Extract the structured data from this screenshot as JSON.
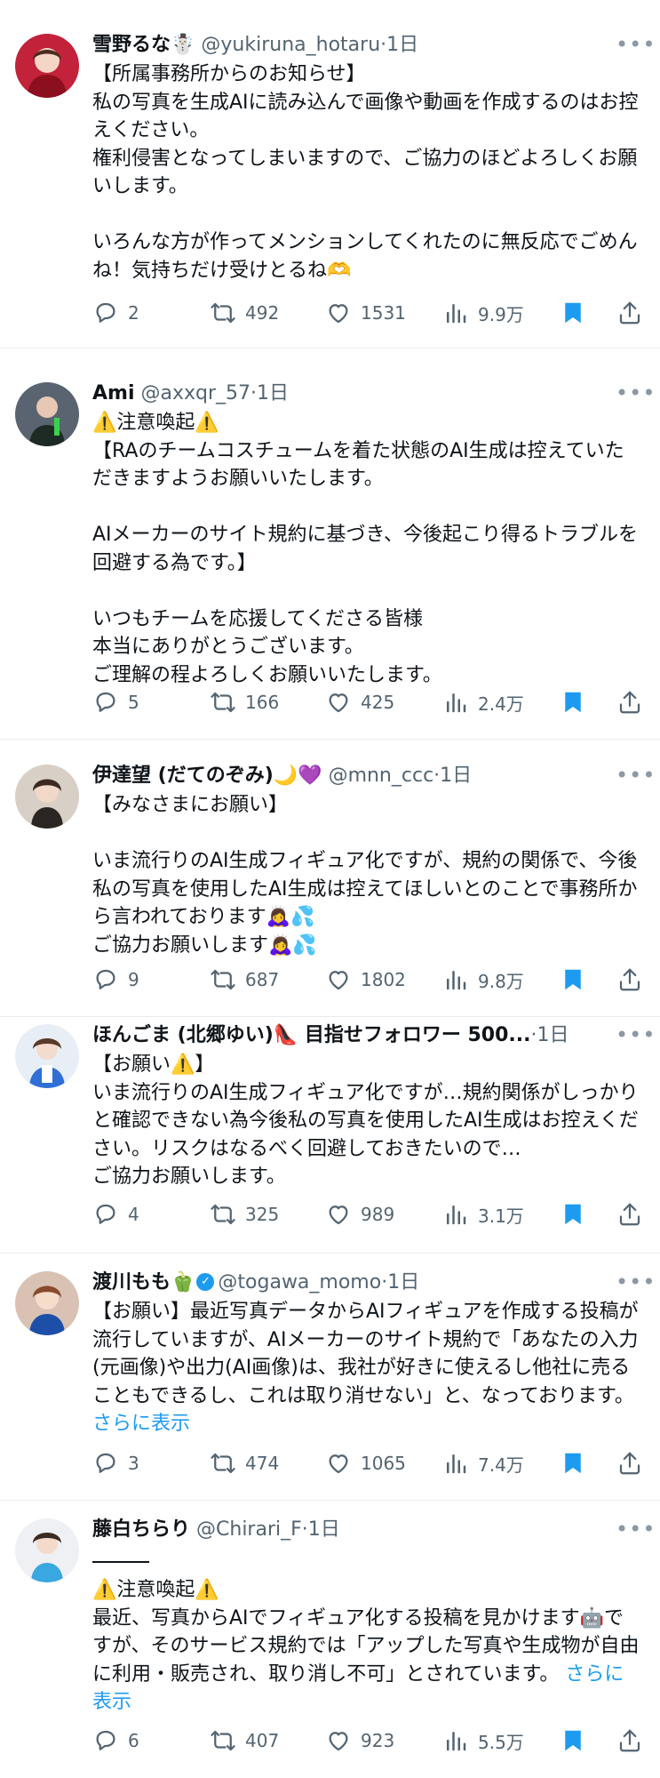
{
  "tweets": [
    {
      "name": "雪野るな☃️",
      "handle": "@yukiruna_hotaru",
      "time": "1日",
      "text": "【所属事務所からのお知らせ】\n私の写真を生成AIに読み込んで画像や動画を作成するのはお控えください。\n権利侵害となってしまいますので、ご協力のほどよろしくお願いします。\n\nいろんな方が作ってメンションしてくれたのに無反応でごめんね！気持ちだけ受けとるね🫶",
      "replies": "2",
      "retweets": "492",
      "likes": "1531",
      "views": "9.9万"
    },
    {
      "name": "Ami",
      "handle": "@axxqr_57",
      "time": "1日",
      "text": "⚠️注意喚起⚠️\n【RAのチームコスチュームを着た状態のAI生成は控えていただきますようお願いいたします。\n\nAIメーカーのサイト規約に基づき、今後起こり得るトラブルを回避する為です。】\n\nいつもチームを応援してくださる皆様\n本当にありがとうございます。\nご理解の程よろしくお願いいたします。",
      "replies": "5",
      "retweets": "166",
      "likes": "425",
      "views": "2.4万"
    },
    {
      "name": "伊達望 (だてのぞみ)🌙💜",
      "handle": "@mnn_ccc",
      "time": "1日",
      "text": "【みなさまにお願い】\n\nいま流行りのAI生成フィギュア化ですが、規約の関係で、今後私の写真を使用したAI生成は控えてほしいとのことで事務所から言われております🙇‍♀️💦\nご協力お願いします🙇‍♀️💦",
      "replies": "9",
      "retweets": "687",
      "likes": "1802",
      "views": "9.8万"
    },
    {
      "name": "ほんごま (北郷ゆい)👠 目指せフォロワー 500...",
      "handle": "",
      "time": "1日",
      "text": "【お願い⚠️】\nいま流行りのAI生成フィギュア化ですが…規約関係がしっかりと確認できない為今後私の写真を使用したAI生成はお控えください。リスクはなるべく回避しておきたいので…\nご協力お願いします。",
      "replies": "4",
      "retweets": "325",
      "likes": "989",
      "views": "3.1万"
    },
    {
      "name": "渡川もも🫑",
      "handle": "@togawa_momo",
      "time": "1日",
      "text": "【お願い】最近写真データからAIフィギュアを作成する投稿が流行していますが、AIメーカーのサイト規約で「あなたの入力(元画像)や出力(AI画像)は、我社が好きに使えるし他社に売ることもできるし、これは取り消せない」と、なっております。",
      "show_more": "さらに表示",
      "replies": "3",
      "retweets": "474",
      "likes": "1065",
      "views": "7.4万"
    },
    {
      "name": "藤白ちらり",
      "handle": "@Chirari_F",
      "time": "1日",
      "text": "⚠️注意喚起⚠️\n最近、写真からAIでフィギュア化する投稿を見かけます🤖ですが、そのサービス規約では「アップした写真や生成物が自由に利用・販売され、取り消し不可」とされています。",
      "show_more": "さらに表示",
      "replies": "6",
      "retweets": "407",
      "likes": "923",
      "views": "5.5万"
    }
  ],
  "icons": [
    "reply-icon",
    "retweet-icon",
    "like-icon",
    "views-icon",
    "bookmark-icon",
    "share-icon",
    "more-icon",
    "verified-icon"
  ],
  "colors": {
    "accent": "#1d9bf0",
    "text": "#0f1419",
    "muted": "#536471",
    "divider": "#e6ecf0"
  }
}
